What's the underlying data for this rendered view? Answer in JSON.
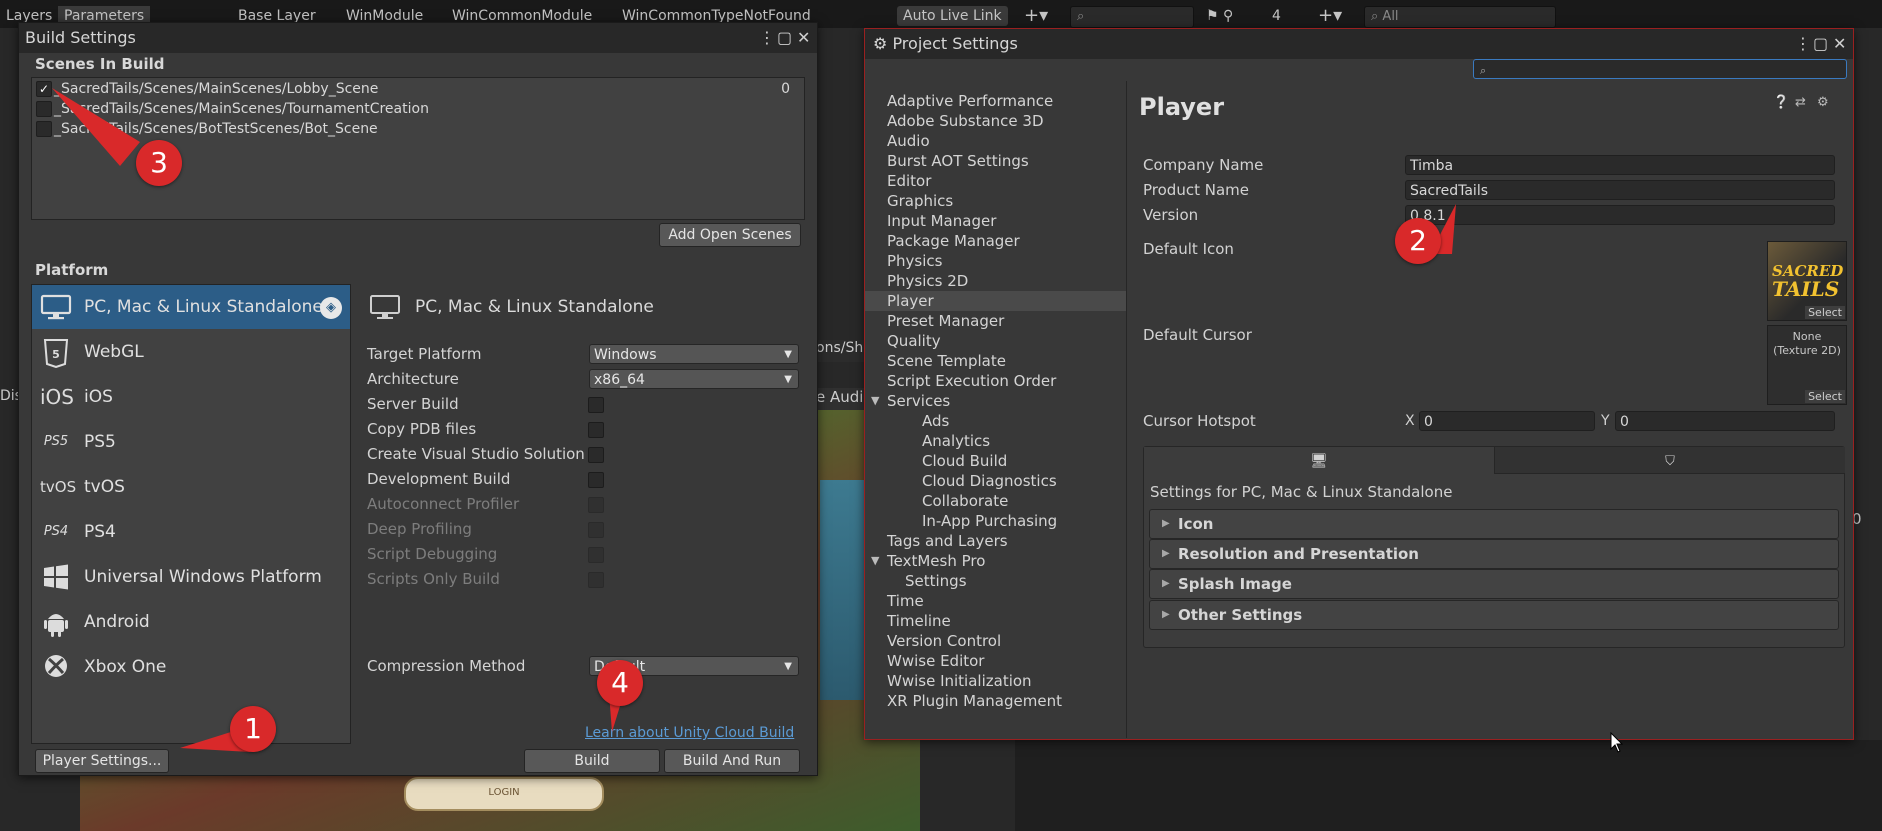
{
  "topbar": {
    "tabs": [
      "Layers",
      "Parameters",
      "Base Layer",
      "WinModule",
      "WinCommonModule",
      "WinCommonTypeNotFound"
    ],
    "auto_live_link": "Auto Live Link",
    "hidden_count": "4",
    "search_all_placeholder": "All"
  },
  "scene_view": {
    "login_label": "LOGIN",
    "path_fragment": "ons/Shi",
    "audio_fragment": "e Audi",
    "dis_fragment": "Dis",
    "right_zero": "0"
  },
  "build_settings": {
    "title": "Build Settings",
    "scenes_in_build_label": "Scenes In Build",
    "scenes": [
      {
        "name": "_SacredTails/Scenes/MainScenes/Lobby_Scene",
        "checked": true,
        "index": "0"
      },
      {
        "name": "_SacredTails/Scenes/MainScenes/TournamentCreation",
        "checked": false,
        "index": ""
      },
      {
        "name": "_SacredTails/Scenes/BotTestScenes/Bot_Scene",
        "checked": false,
        "index": ""
      }
    ],
    "add_open_scenes": "Add Open Scenes",
    "platform_label": "Platform",
    "platforms": [
      {
        "label": "PC, Mac & Linux Standalone",
        "icon": "monitor-icon",
        "selected": true
      },
      {
        "label": "WebGL",
        "icon": "html5-icon",
        "selected": false
      },
      {
        "label": "iOS",
        "icon": "ios-icon",
        "selected": false
      },
      {
        "label": "PS5",
        "icon": "ps5-icon",
        "selected": false
      },
      {
        "label": "tvOS",
        "icon": "tvos-icon",
        "selected": false
      },
      {
        "label": "PS4",
        "icon": "ps4-icon",
        "selected": false
      },
      {
        "label": "Universal Windows Platform",
        "icon": "windows-icon",
        "selected": false
      },
      {
        "label": "Android",
        "icon": "android-icon",
        "selected": false
      },
      {
        "label": "Xbox One",
        "icon": "xbox-icon",
        "selected": false
      }
    ],
    "platform_heading": "PC, Mac & Linux Standalone",
    "target_platform_label": "Target Platform",
    "target_platform_value": "Windows",
    "architecture_label": "Architecture",
    "architecture_value": "x86_64",
    "options": [
      {
        "label": "Server Build",
        "enabled": true
      },
      {
        "label": "Copy PDB files",
        "enabled": true
      },
      {
        "label": "Create Visual Studio Solution",
        "enabled": true
      },
      {
        "label": "Development Build",
        "enabled": true
      },
      {
        "label": "Autoconnect Profiler",
        "enabled": false
      },
      {
        "label": "Deep Profiling",
        "enabled": false
      },
      {
        "label": "Script Debugging",
        "enabled": false
      },
      {
        "label": "Scripts Only Build",
        "enabled": false
      }
    ],
    "compression_label": "Compression Method",
    "compression_value": "Default",
    "cloud_build_link": "Learn about Unity Cloud Build",
    "player_settings_button": "Player Settings...",
    "build_button": "Build",
    "build_and_run_button": "Build And Run"
  },
  "project_settings": {
    "title": "Project Settings",
    "nav": [
      {
        "label": "Adaptive Performance",
        "level": 0
      },
      {
        "label": "Adobe Substance 3D",
        "level": 0
      },
      {
        "label": "Audio",
        "level": 0
      },
      {
        "label": "Burst AOT Settings",
        "level": 0
      },
      {
        "label": "Editor",
        "level": 0
      },
      {
        "label": "Graphics",
        "level": 0
      },
      {
        "label": "Input Manager",
        "level": 0
      },
      {
        "label": "Package Manager",
        "level": 0
      },
      {
        "label": "Physics",
        "level": 0
      },
      {
        "label": "Physics 2D",
        "level": 0
      },
      {
        "label": "Player",
        "level": 0,
        "selected": true
      },
      {
        "label": "Preset Manager",
        "level": 0
      },
      {
        "label": "Quality",
        "level": 0
      },
      {
        "label": "Scene Template",
        "level": 0
      },
      {
        "label": "Script Execution Order",
        "level": 0
      },
      {
        "label": "Services",
        "level": 0,
        "foldout": true
      },
      {
        "label": "Ads",
        "level": 2
      },
      {
        "label": "Analytics",
        "level": 2
      },
      {
        "label": "Cloud Build",
        "level": 2
      },
      {
        "label": "Cloud Diagnostics",
        "level": 2
      },
      {
        "label": "Collaborate",
        "level": 2
      },
      {
        "label": "In-App Purchasing",
        "level": 2
      },
      {
        "label": "Tags and Layers",
        "level": 0
      },
      {
        "label": "TextMesh Pro",
        "level": 0,
        "foldout": true
      },
      {
        "label": "Settings",
        "level": 1
      },
      {
        "label": "Time",
        "level": 0
      },
      {
        "label": "Timeline",
        "level": 0
      },
      {
        "label": "Version Control",
        "level": 0
      },
      {
        "label": "Wwise Editor",
        "level": 0
      },
      {
        "label": "Wwise Initialization",
        "level": 0
      },
      {
        "label": "XR Plugin Management",
        "level": 0
      }
    ],
    "player": {
      "heading": "Player",
      "company_name_label": "Company Name",
      "company_name": "Timba",
      "product_name_label": "Product Name",
      "product_name": "SacredTails",
      "version_label": "Version",
      "version": "0.8.1",
      "default_icon_label": "Default Icon",
      "icon_logo_line1": "SACRED",
      "icon_logo_line2": "TAILS",
      "select_label": "Select",
      "default_cursor_label": "Default Cursor",
      "cursor_none_line1": "None",
      "cursor_none_line2": "(Texture 2D)",
      "cursor_hotspot_label": "Cursor Hotspot",
      "hotspot_x_label": "X",
      "hotspot_x": "0",
      "hotspot_y_label": "Y",
      "hotspot_y": "0",
      "settings_for": "Settings for PC, Mac & Linux Standalone",
      "foldouts": [
        "Icon",
        "Resolution and Presentation",
        "Splash Image",
        "Other Settings"
      ]
    }
  },
  "callouts": [
    "1",
    "2",
    "3",
    "4"
  ],
  "colors": {
    "selection_blue": "#2c5d87",
    "callout_red": "#d9292a",
    "link_blue": "#5b9bd5",
    "window_bg": "#383838"
  }
}
